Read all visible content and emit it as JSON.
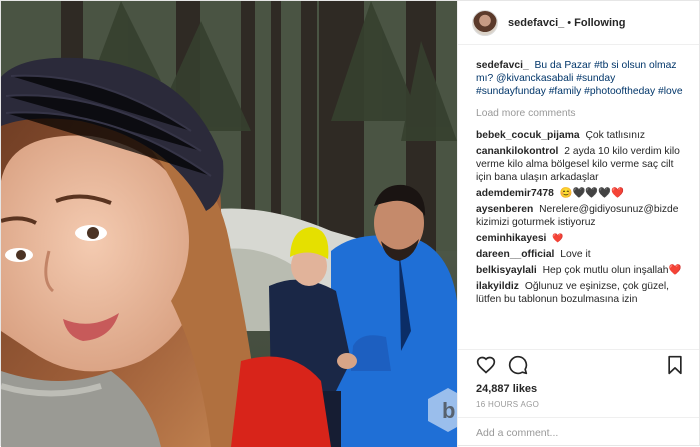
{
  "header": {
    "username": "sedefavci_",
    "separator": "•",
    "follow_status": "Following"
  },
  "caption": {
    "user": "sedefavci_",
    "text": "Bu da Pazar #tb si olsun olmaz mı? @kivanckasabali #sunday #sundayfunday #family #photooftheday #love"
  },
  "load_more": "Load more comments",
  "comments": [
    {
      "user": "bebek_cocuk_pijama",
      "text": "Çok tatlısınız"
    },
    {
      "user": "canankilokontrol",
      "text": "2 ayda 10 kilo verdim kilo verme kilo alma bölgesel kilo verme saç cilt için bana ulaşın arkadaşlar"
    },
    {
      "user": "ademdemir7478",
      "text": "😊🖤🖤🖤❤️"
    },
    {
      "user": "aysenberen",
      "text": "Nerelere@gidiyosunuz@bizde kizimizi goturmek istiyoruz"
    },
    {
      "user": "ceminhikayesi",
      "text": "❤️"
    },
    {
      "user": "dareen__official",
      "text": "Love it"
    },
    {
      "user": "belkisyaylali",
      "text": "Hep çok mutlu olun inşallah❤️"
    },
    {
      "user": "ilakyildiz",
      "text": "Oğlunuz ve eşinizse, çok güzel, lütfen bu tablonun bozulmasına izin"
    }
  ],
  "likes": "24,887 likes",
  "timestamp": "16 HOURS AGO",
  "add_comment_placeholder": "Add a comment...",
  "icons": [
    "heart-icon",
    "comment-icon",
    "bookmark-icon"
  ]
}
